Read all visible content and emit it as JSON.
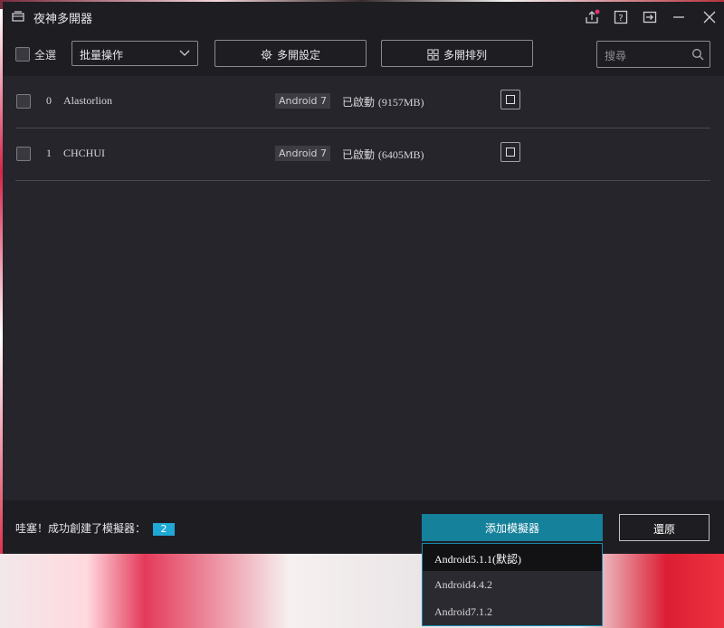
{
  "window": {
    "title": "夜神多開器"
  },
  "toolbar": {
    "select_all_label": "全選",
    "batch_select_value": "批量操作",
    "multi_settings_label": "多開設定",
    "multi_arrange_label": "多開排列",
    "search_placeholder": "搜尋"
  },
  "instances": [
    {
      "index": "0",
      "name": "Alastorlion",
      "android": "Android 7",
      "status": "已啟動",
      "memory": "(9157MB)"
    },
    {
      "index": "1",
      "name": "CHCHUI",
      "android": "Android 7",
      "status": "已啟動",
      "memory": "(6405MB)"
    }
  ],
  "footer": {
    "message": "哇塞！成功創建了模擬器：",
    "count": "2",
    "add_emulator_label": "添加模擬器",
    "restore_label": "還原"
  },
  "android_menu": {
    "options": [
      "Android5.1.1(默認)",
      "Android4.4.2",
      "Android7.1.2"
    ],
    "highlighted_index": 0
  },
  "colors": {
    "accent": "#15819b",
    "count_badge": "#1fa7d6",
    "window_bg": "#26252b",
    "titlebar_bg": "#1e1d22",
    "notification_dot": "#e6336b"
  }
}
